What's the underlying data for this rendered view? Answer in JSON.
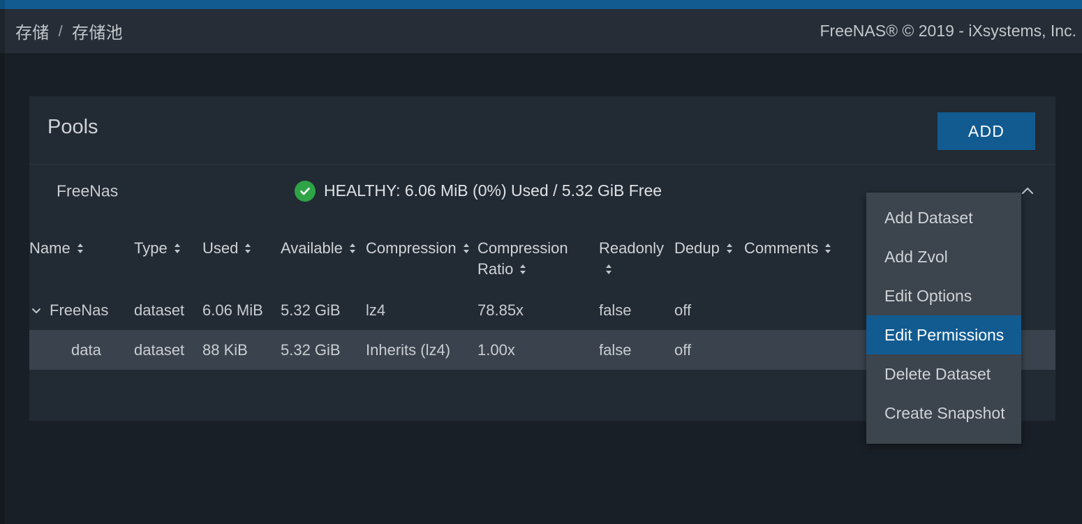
{
  "topbar": {
    "accent_color": "#115b91"
  },
  "header": {
    "breadcrumb": {
      "root": "存储",
      "separator": "/",
      "current": "存储池"
    },
    "copyright": "FreeNAS® © 2019 - iXsystems, Inc."
  },
  "card": {
    "title": "Pools",
    "add_button_label": "ADD",
    "pool": {
      "name": "FreeNas",
      "status_icon": "check-circle-icon",
      "status_color": "#2ea446",
      "status_text": "HEALTHY: 6.06 MiB (0%) Used / 5.32 GiB Free",
      "collapse_icon": "chevron-up-icon",
      "settings_icon": "gear-icon"
    },
    "table": {
      "columns": [
        {
          "label": "Name",
          "sortable": true
        },
        {
          "label": "Type",
          "sortable": true
        },
        {
          "label": "Used",
          "sortable": true
        },
        {
          "label": "Available",
          "sortable": true
        },
        {
          "label": "Compression",
          "sortable": true
        },
        {
          "label": "Compression Ratio",
          "sortable": true
        },
        {
          "label": "Readonly",
          "sortable": true
        },
        {
          "label": "Dedup",
          "sortable": true
        },
        {
          "label": "Comments",
          "sortable": true
        }
      ],
      "rows": [
        {
          "expand_icon": "chevron-down-icon",
          "indent": false,
          "selected": false,
          "name": "FreeNas",
          "type": "dataset",
          "used": "6.06 MiB",
          "available": "5.32 GiB",
          "compression": "lz4",
          "compression_ratio": "78.85x",
          "readonly": "false",
          "dedup": "off",
          "comments": ""
        },
        {
          "expand_icon": "",
          "indent": true,
          "selected": true,
          "name": "data",
          "type": "dataset",
          "used": "88 KiB",
          "available": "5.32 GiB",
          "compression": "Inherits (lz4)",
          "compression_ratio": "1.00x",
          "readonly": "false",
          "dedup": "off",
          "comments": ""
        }
      ]
    }
  },
  "context_menu": {
    "highlight_color": "#115b91",
    "items": [
      {
        "label": "Add Dataset",
        "active": false
      },
      {
        "label": "Add Zvol",
        "active": false
      },
      {
        "label": "Edit Options",
        "active": false
      },
      {
        "label": "Edit Permissions",
        "active": true
      },
      {
        "label": "Delete Dataset",
        "active": false
      },
      {
        "label": "Create Snapshot",
        "active": false
      }
    ]
  }
}
